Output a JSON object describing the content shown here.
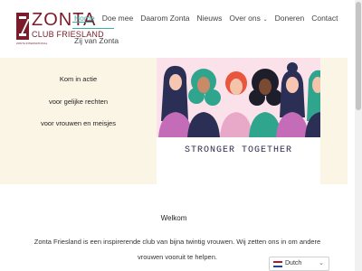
{
  "logo": {
    "name": "ZONTA",
    "club": "CLUB FRIESLAND",
    "tagline": "ZONTA INTERNATIONAL"
  },
  "nav": {
    "items": [
      {
        "label": "Home"
      },
      {
        "label": "Doe mee"
      },
      {
        "label": "Daarom Zonta"
      },
      {
        "label": "Nieuws"
      },
      {
        "label": "Over ons"
      },
      {
        "label": "Doneren"
      },
      {
        "label": "Contact"
      }
    ],
    "second_row": "Zij van Zonta"
  },
  "hero": {
    "line1": "Kom in actie",
    "line2": "voor gelijke rechten",
    "line3": "voor vrouwen en meisjes",
    "image_caption": "STRONGER TOGETHER"
  },
  "welcome": {
    "title": "Welkom",
    "line1": "Zonta Friesland is een inspirerende club van bijna twintig vrouwen. Wij zetten ons in om andere",
    "line2": "vrouwen vooruit te helpen."
  },
  "language": {
    "selected": "Dutch"
  },
  "colors": {
    "brand": "#7a1c2a",
    "accent": "#3bb0a3",
    "hero_bg": "#fbf5e6",
    "image_bg": "#fbe2ea"
  }
}
